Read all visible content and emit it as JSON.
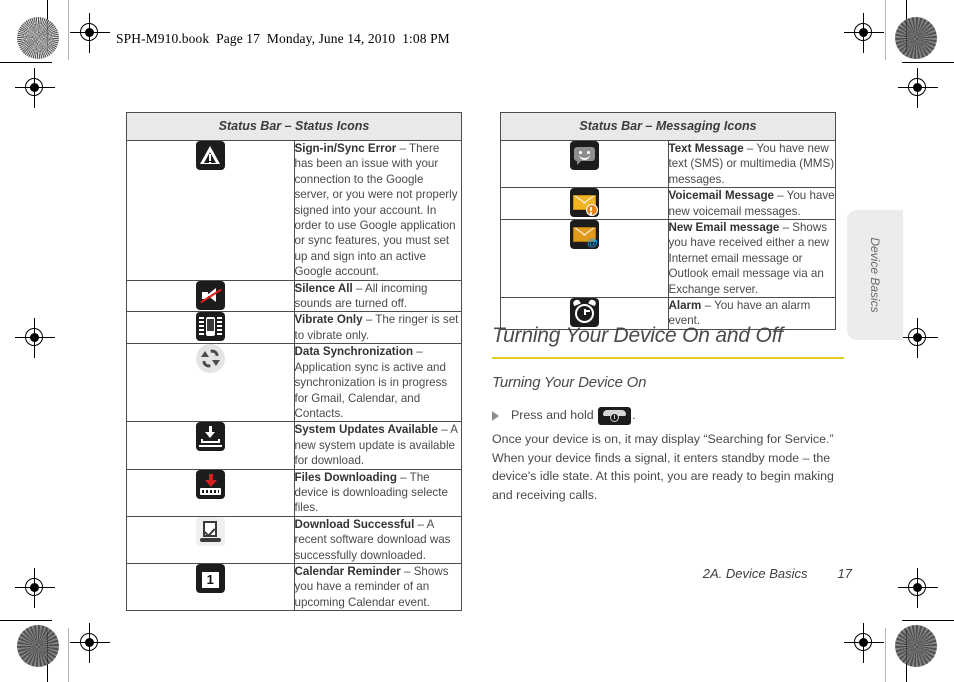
{
  "page": {
    "running_header": "SPH-M910.book  Page 17  Monday, June 14, 2010  1:08 PM",
    "footer_chapter": "2A. Device Basics",
    "footer_page_number": "17",
    "thumb_tab_label": "Device Basics",
    "accent_rule_color": "#e2cc22",
    "table_header_fill": "#e9e9e9",
    "body_text_color": "#4a4a4a"
  },
  "status_icons_table": {
    "header": "Status Bar – Status Icons",
    "rows": [
      {
        "icon": "warning-triangle-icon",
        "term": "Sign-in/Sync Error",
        "dash": " – ",
        "description": "There has been an issue with your connection to the Google server, or you were not properly signed into your account. In order to use Google application or sync features, you must set up and sign into an active Google account."
      },
      {
        "icon": "mute-speaker-icon",
        "term": "Silence All",
        "dash": " – ",
        "description": "All incoming sounds are turned off."
      },
      {
        "icon": "vibrate-phone-icon",
        "term": "Vibrate Only",
        "dash": " – ",
        "description": "The ringer is set to vibrate only."
      },
      {
        "icon": "sync-arrows-icon",
        "term": "Data Synchronization",
        "dash": " – ",
        "description": "Application sync is active and synchronization is in progress for Gmail, Calendar, and Contacts."
      },
      {
        "icon": "system-update-icon",
        "term": "System Updates Available",
        "dash": " – ",
        "description": "A new system update is available for download."
      },
      {
        "icon": "download-arrow-icon",
        "term": "Files Downloading",
        "dash": " – ",
        "description": "The device is downloading selecte files."
      },
      {
        "icon": "download-complete-icon",
        "term": "Download Successful",
        "dash": " – ",
        "description": "A recent software download was successfully downloaded."
      },
      {
        "icon": "calendar-reminder-icon",
        "term": "Calendar Reminder",
        "dash": " – ",
        "description": "Shows you have a reminder of an upcoming Calendar event.",
        "icon_text": "1"
      }
    ]
  },
  "messaging_icons_table": {
    "header": "Status Bar – Messaging Icons",
    "rows": [
      {
        "icon": "text-message-bubble-icon",
        "term": "Text Message",
        "dash": " – ",
        "description": "You have new text (SMS) or multimedia (MMS) messages."
      },
      {
        "icon": "voicemail-envelope-icon",
        "term": "Voicemail Message",
        "dash": " – ",
        "description": "You have new voicemail messages."
      },
      {
        "icon": "new-email-envelope-icon",
        "term": "New Email message",
        "dash": " – ",
        "description": "Shows you have received either a new Internet email message or Outlook email message via an Exchange server."
      },
      {
        "icon": "alarm-clock-icon",
        "term": "Alarm",
        "dash": " – ",
        "description": "You have an alarm event."
      }
    ]
  },
  "section": {
    "heading": "Turning Your Device On and Off",
    "subheading": "Turning Your Device On",
    "bullet_text_before": "Press and hold",
    "bullet_key_icon": "power-key-icon",
    "bullet_text_after": ".",
    "paragraph": "Once your device is on, it may display “Searching for Service.” When your device finds a signal, it enters standby mode – the device's idle state. At this point, you are ready to begin making and receiving calls."
  }
}
